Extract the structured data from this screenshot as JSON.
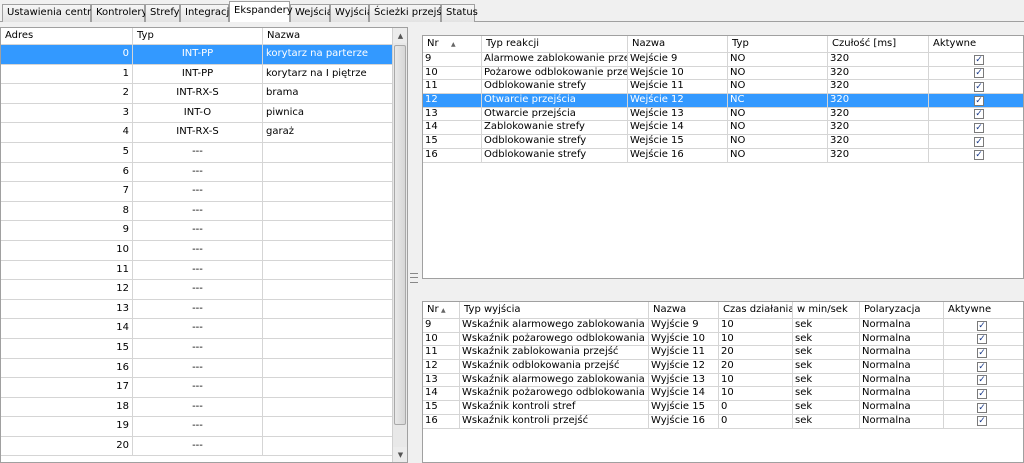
{
  "tabs": [
    {
      "label": "Ustawienia centrali",
      "active": false
    },
    {
      "label": "Kontrolery",
      "active": false
    },
    {
      "label": "Strefy",
      "active": false
    },
    {
      "label": "Integracja",
      "active": false
    },
    {
      "label": "Ekspandery",
      "active": true
    },
    {
      "label": "Wejścia",
      "active": false
    },
    {
      "label": "Wyjścia",
      "active": false
    },
    {
      "label": "Ścieżki przejść",
      "active": false
    },
    {
      "label": "Status",
      "active": false
    }
  ],
  "expanders": {
    "columns": [
      "Adres",
      "Typ",
      "Nazwa"
    ],
    "selected_index": 0,
    "rows": [
      {
        "adres": "0",
        "typ": "INT-PP",
        "nazwa": "korytarz na parterze"
      },
      {
        "adres": "1",
        "typ": "INT-PP",
        "nazwa": "korytarz na I piętrze"
      },
      {
        "adres": "2",
        "typ": "INT-RX-S",
        "nazwa": "brama"
      },
      {
        "adres": "3",
        "typ": "INT-O",
        "nazwa": "piwnica"
      },
      {
        "adres": "4",
        "typ": "INT-RX-S",
        "nazwa": "garaż"
      },
      {
        "adres": "5",
        "typ": "---",
        "nazwa": ""
      },
      {
        "adres": "6",
        "typ": "---",
        "nazwa": ""
      },
      {
        "adres": "7",
        "typ": "---",
        "nazwa": ""
      },
      {
        "adres": "8",
        "typ": "---",
        "nazwa": ""
      },
      {
        "adres": "9",
        "typ": "---",
        "nazwa": ""
      },
      {
        "adres": "10",
        "typ": "---",
        "nazwa": ""
      },
      {
        "adres": "11",
        "typ": "---",
        "nazwa": ""
      },
      {
        "adres": "12",
        "typ": "---",
        "nazwa": ""
      },
      {
        "adres": "13",
        "typ": "---",
        "nazwa": ""
      },
      {
        "adres": "14",
        "typ": "---",
        "nazwa": ""
      },
      {
        "adres": "15",
        "typ": "---",
        "nazwa": ""
      },
      {
        "adres": "16",
        "typ": "---",
        "nazwa": ""
      },
      {
        "adres": "17",
        "typ": "---",
        "nazwa": ""
      },
      {
        "adres": "18",
        "typ": "---",
        "nazwa": ""
      },
      {
        "adres": "19",
        "typ": "---",
        "nazwa": ""
      },
      {
        "adres": "20",
        "typ": "---",
        "nazwa": ""
      }
    ]
  },
  "inputs": {
    "columns": [
      "Nr",
      "Typ reakcji",
      "Nazwa",
      "Typ",
      "Czułość [ms]",
      "Aktywne"
    ],
    "selected_index": 3,
    "rows": [
      {
        "nr": "9",
        "typ_reakcji": "Alarmowe zablokowanie przejścia",
        "nazwa": "Wejście 9",
        "typ": "NO",
        "czulosc": "320",
        "aktywne": true
      },
      {
        "nr": "10",
        "typ_reakcji": "Pożarowe odblokowanie przejścia",
        "nazwa": "Wejście 10",
        "typ": "NO",
        "czulosc": "320",
        "aktywne": true
      },
      {
        "nr": "11",
        "typ_reakcji": "Odblokowanie strefy",
        "nazwa": "Wejście 11",
        "typ": "NO",
        "czulosc": "320",
        "aktywne": true
      },
      {
        "nr": "12",
        "typ_reakcji": "Otwarcie przejścia",
        "nazwa": "Wejście 12",
        "typ": "NC",
        "czulosc": "320",
        "aktywne": true
      },
      {
        "nr": "13",
        "typ_reakcji": "Otwarcie przejścia",
        "nazwa": "Wejście 13",
        "typ": "NO",
        "czulosc": "320",
        "aktywne": true
      },
      {
        "nr": "14",
        "typ_reakcji": "Zablokowanie strefy",
        "nazwa": "Wejście 14",
        "typ": "NO",
        "czulosc": "320",
        "aktywne": true
      },
      {
        "nr": "15",
        "typ_reakcji": "Odblokowanie strefy",
        "nazwa": "Wejście 15",
        "typ": "NO",
        "czulosc": "320",
        "aktywne": true
      },
      {
        "nr": "16",
        "typ_reakcji": "Odblokowanie strefy",
        "nazwa": "Wejście 16",
        "typ": "NO",
        "czulosc": "320",
        "aktywne": true
      }
    ]
  },
  "outputs": {
    "columns": [
      "Nr",
      "Typ wyjścia",
      "Nazwa",
      "Czas działania",
      "w min/sek",
      "Polaryzacja",
      "Aktywne"
    ],
    "rows": [
      {
        "nr": "9",
        "typ_wyjscia": "Wskaźnik alarmowego zablokowania stref",
        "nazwa": "Wyjście 9",
        "czas": "10",
        "jednostka": "sek",
        "polaryzacja": "Normalna",
        "aktywne": true
      },
      {
        "nr": "10",
        "typ_wyjscia": "Wskaźnik pożarowego odblokowania stref",
        "nazwa": "Wyjście 10",
        "czas": "10",
        "jednostka": "sek",
        "polaryzacja": "Normalna",
        "aktywne": true
      },
      {
        "nr": "11",
        "typ_wyjscia": "Wskaźnik zablokowania przejść",
        "nazwa": "Wyjście 11",
        "czas": "20",
        "jednostka": "sek",
        "polaryzacja": "Normalna",
        "aktywne": true
      },
      {
        "nr": "12",
        "typ_wyjscia": "Wskaźnik odblokowania przejść",
        "nazwa": "Wyjście 12",
        "czas": "20",
        "jednostka": "sek",
        "polaryzacja": "Normalna",
        "aktywne": true
      },
      {
        "nr": "13",
        "typ_wyjscia": "Wskaźnik alarmowego zablokowania przejść",
        "nazwa": "Wyjście 13",
        "czas": "10",
        "jednostka": "sek",
        "polaryzacja": "Normalna",
        "aktywne": true
      },
      {
        "nr": "14",
        "typ_wyjscia": "Wskaźnik pożarowego odblokowania przejść",
        "nazwa": "Wyjście 14",
        "czas": "10",
        "jednostka": "sek",
        "polaryzacja": "Normalna",
        "aktywne": true
      },
      {
        "nr": "15",
        "typ_wyjscia": "Wskaźnik kontroli stref",
        "nazwa": "Wyjście 15",
        "czas": "0",
        "jednostka": "sek",
        "polaryzacja": "Normalna",
        "aktywne": true
      },
      {
        "nr": "16",
        "typ_wyjscia": "Wskaźnik kontroli przejść",
        "nazwa": "Wyjście 16",
        "czas": "0",
        "jednostka": "sek",
        "polaryzacja": "Normalna",
        "aktywne": true
      }
    ]
  },
  "icons": {
    "checkmark": "check-icon",
    "sort": "sort-asc-icon",
    "scroll_up": "arrow-up-icon",
    "scroll_down": "arrow-down-icon"
  },
  "colors": {
    "selection": "#3399ff",
    "grid_line": "#d5d5d5"
  }
}
